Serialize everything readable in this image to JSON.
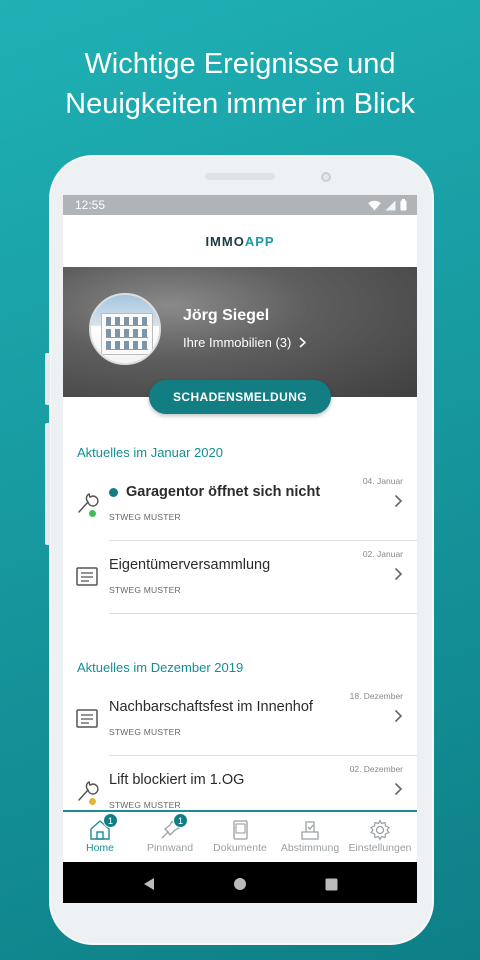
{
  "headline": {
    "line1": "Wichtige Ereignisse und",
    "line2": "Neuigkeiten immer im Blick"
  },
  "status_bar": {
    "time": "12:55"
  },
  "app": {
    "logo_part1": "IMMO",
    "logo_part2": "APP"
  },
  "profile": {
    "name": "Jörg Siegel",
    "properties_link": "Ihre Immobilien (3)",
    "report_button": "SCHADENSMELDUNG"
  },
  "sections": [
    {
      "title": "Aktuelles im Januar 2020",
      "items": [
        {
          "icon": "wrench-icon",
          "status": "green",
          "unread": true,
          "title": "Garagentor öffnet sich nicht",
          "subtitle": "STWEG MUSTER",
          "date": "04. Januar"
        },
        {
          "icon": "document-icon",
          "unread": false,
          "title": "Eigentümerversammlung",
          "subtitle": "STWEG MUSTER",
          "date": "02. Januar"
        }
      ]
    },
    {
      "title": "Aktuelles im Dezember 2019",
      "items": [
        {
          "icon": "document-icon",
          "unread": false,
          "title": "Nachbarschaftsfest im Innenhof",
          "subtitle": "STWEG MUSTER",
          "date": "18. Dezember"
        },
        {
          "icon": "wrench-icon",
          "status": "yellow",
          "unread": false,
          "title": "Lift blockiert im 1.OG",
          "subtitle": "STWEG MUSTER",
          "date": "02. Dezember"
        }
      ]
    }
  ],
  "bottom_nav": [
    {
      "label": "Home",
      "icon": "home-icon",
      "active": true,
      "badge": "1"
    },
    {
      "label": "Pinnwand",
      "icon": "pin-icon",
      "active": false,
      "badge": "1"
    },
    {
      "label": "Dokumente",
      "icon": "documents-icon",
      "active": false
    },
    {
      "label": "Abstimmung",
      "icon": "vote-icon",
      "active": false
    },
    {
      "label": "Einstellungen",
      "icon": "gear-icon",
      "active": false
    }
  ],
  "colors": {
    "accent": "#127e84",
    "accent_text": "#148e94",
    "status_green": "#3fbf5a",
    "status_yellow": "#e8b33a"
  }
}
